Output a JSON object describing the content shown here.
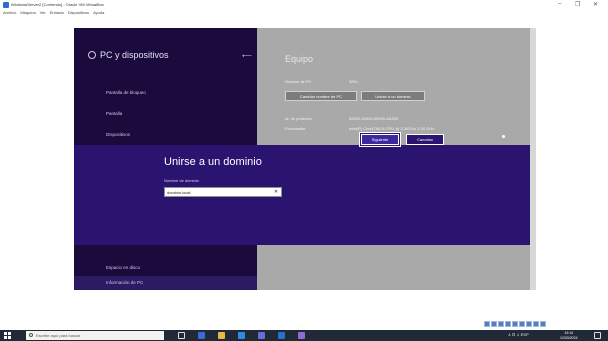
{
  "host": {
    "title": "WindowsServer2 [Corriendo] - Oracle VM VirtualBox",
    "menu": [
      "Archivo",
      "Máquina",
      "Ver",
      "Entrada",
      "Dispositivos",
      "Ayuda"
    ],
    "controls": {
      "minimize": "–",
      "restore": "❐",
      "close": "✕"
    }
  },
  "settings": {
    "left_title": "PC y dispositivos",
    "back_icon": "back-arrow-icon",
    "items_top": [
      "Pantalla de bloqueo",
      "Pantalla",
      "Dispositivos"
    ],
    "items_bottom": [
      "Espacio en disco",
      "Información de PC"
    ],
    "right_title": "Equipo",
    "pc_name_label": "Nombre de PC",
    "pc_name_value": "WIN-...",
    "btn_rename": "Cambiar nombre de PC",
    "btn_join_domain": "Unirse a un dominio",
    "product_id_label": "Id. de producto",
    "product_id_value": "00000-00000-00000-AA000",
    "processor_label": "Procesador",
    "processor_value": "Intel(R) Core(TM) i5 CPU @ 2.30GHz 2.30 GHz"
  },
  "dialog": {
    "title": "Unirse a un dominio",
    "domain_label": "Nombre de dominio",
    "domain_value": "dominio.local",
    "next_button": "Siguiente",
    "cancel_button": "Cancelar"
  },
  "taskbar": {
    "search_placeholder": "Escribe aquí para buscar",
    "tray": "∧  ⊡  ♫  ESP",
    "time": "19:14",
    "date": "12/03/2024"
  },
  "colors": {
    "left_pane": "#1b0b3d",
    "dialog": "#2a1470",
    "overlay_gray": "#a9a9a9",
    "taskbar": "#1f2a36"
  }
}
